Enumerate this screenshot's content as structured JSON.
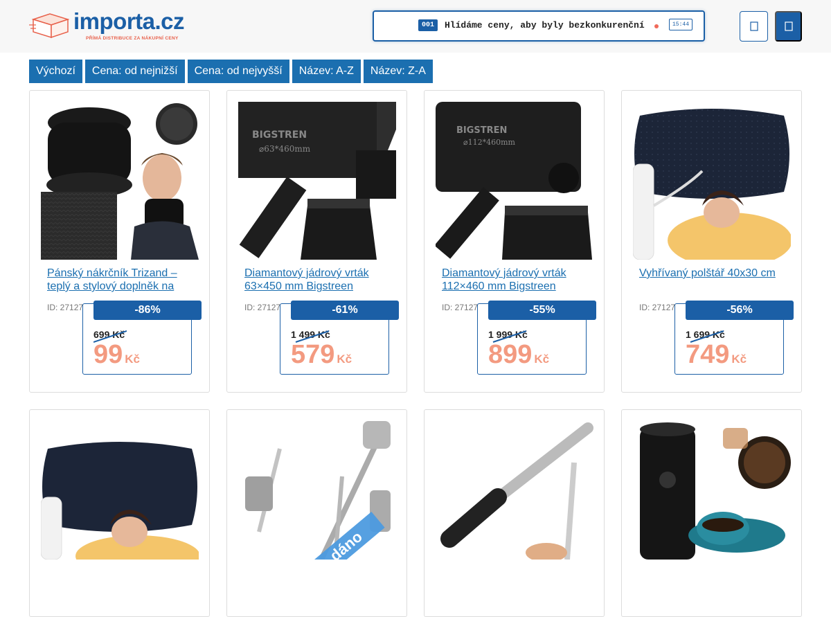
{
  "header": {
    "logo_text": "importa.cz",
    "logo_tagline": "PŘÍMÁ DISTRIBUCE ZA NÁKUPNÍ CENY",
    "ticker": {
      "badge": "001",
      "text": "Hlídáme ceny, aby byly bezkonkurenční",
      "time": "15:44"
    },
    "buttons": [
      {
        "icon": "user-icon"
      },
      {
        "icon": "cart-icon"
      }
    ]
  },
  "sort_options": [
    "Výchozí",
    "Cena: od nejnižší",
    "Cena: od nejvyšší",
    "Název: A-Z",
    "Název: Z-A"
  ],
  "products": [
    {
      "title": "Pánský nákrčník Trizand – teplý a stylový doplněk na zimu",
      "id": "ID: 27127",
      "discount": "-86%",
      "old_price": "699 Kč",
      "new_price": "99",
      "currency": "Kč"
    },
    {
      "title": "Diamantový jádrový vrták 63×450 mm Bigstreen",
      "id": "ID: 27127",
      "discount": "-61%",
      "old_price": "1 499 Kč",
      "new_price": "579",
      "currency": "Kč"
    },
    {
      "title": "Diamantový jádrový vrták 112×460 mm Bigstreen",
      "id": "ID: 27127",
      "discount": "-55%",
      "old_price": "1 999 Kč",
      "new_price": "899",
      "currency": "Kč"
    },
    {
      "title": "Vyhřívaný polštář 40x30 cm",
      "id": "ID: 27127",
      "discount": "-56%",
      "old_price": "1 699 Kč",
      "new_price": "749",
      "currency": "Kč"
    }
  ],
  "second_row": [
    {
      "image": "heated-pillow-image"
    },
    {
      "image": "cordless-vacuum-image",
      "ribbon": "dáno"
    },
    {
      "image": "knife-sharpener-image"
    },
    {
      "image": "coffee-grinder-image"
    }
  ],
  "colors": {
    "brand": "#1b5fa6",
    "price": "#f39a80",
    "link": "#1b6fb0",
    "accent": "#e8604a"
  }
}
